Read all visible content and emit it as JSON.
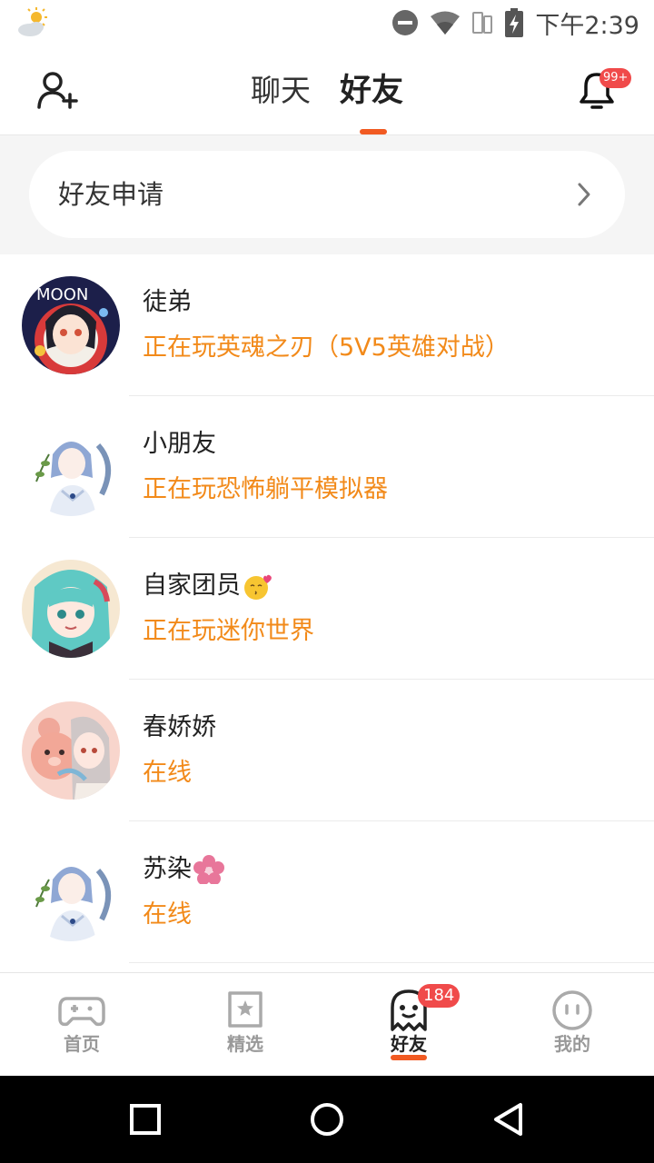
{
  "status_bar": {
    "time": "下午2:39"
  },
  "header": {
    "tabs": [
      {
        "label": "聊天",
        "active": false
      },
      {
        "label": "好友",
        "active": true
      }
    ],
    "notification_badge": "99+",
    "accent_color": "#f15a22"
  },
  "friend_requests": {
    "label": "好友申请"
  },
  "friends": [
    {
      "name": "徒弟",
      "status": "正在玩英魂之刃（5V5英雄对战）",
      "avatar_icon": "avatar-moon-girl"
    },
    {
      "name": "小朋友",
      "status": "正在玩恐怖躺平模拟器",
      "avatar_icon": "avatar-blue-hair-girl"
    },
    {
      "name": "自家团员",
      "status": "正在玩迷你世界",
      "avatar_icon": "avatar-teal-hair-girl",
      "emoji": "kiss-emoji"
    },
    {
      "name": "春娇娇",
      "status": "在线",
      "avatar_icon": "avatar-bear-girl"
    },
    {
      "name": "苏染",
      "status": "在线",
      "avatar_icon": "avatar-blue-hair-girl",
      "emoji": "cherry-blossom-emoji"
    }
  ],
  "bottom_nav": {
    "items": [
      {
        "label": "首页",
        "icon": "gamepad-icon",
        "active": false
      },
      {
        "label": "精选",
        "icon": "star-bookmark-icon",
        "active": false
      },
      {
        "label": "好友",
        "icon": "ghost-icon",
        "active": true,
        "badge": "184"
      },
      {
        "label": "我的",
        "icon": "face-icon",
        "active": false
      }
    ]
  },
  "status_color": "#f28a1a"
}
